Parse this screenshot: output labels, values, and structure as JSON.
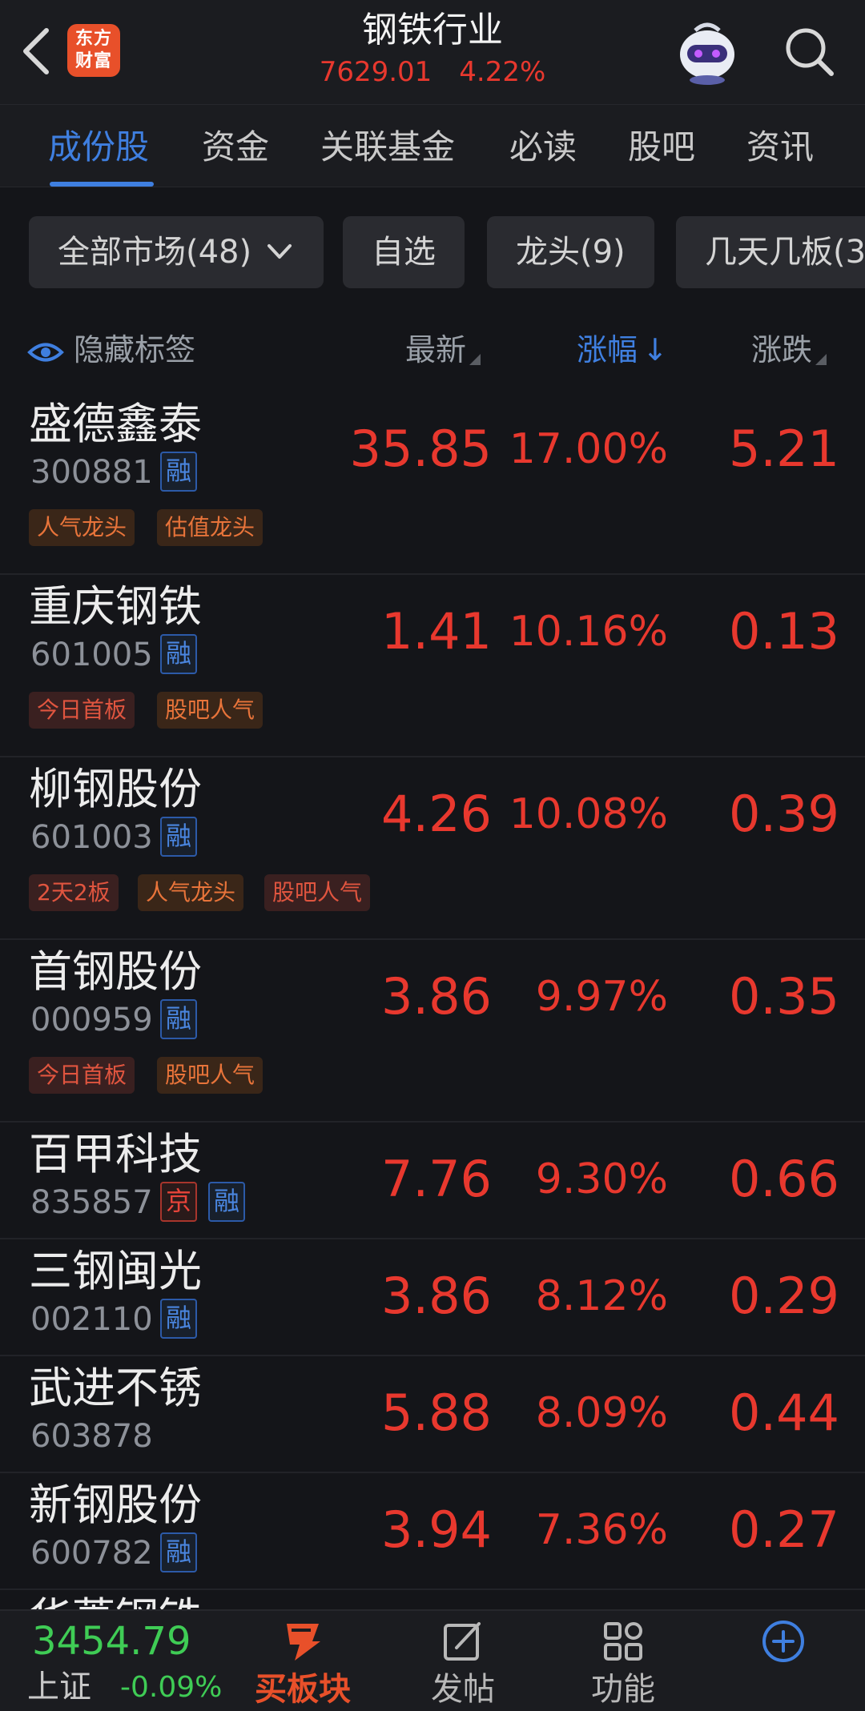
{
  "header": {
    "logo_line1": "东方",
    "logo_line2": "财富",
    "title": "钢铁行业",
    "index_value": "7629.01",
    "index_change": "4.22%"
  },
  "tabs": [
    {
      "label": "成份股",
      "active": true
    },
    {
      "label": "资金"
    },
    {
      "label": "关联基金"
    },
    {
      "label": "必读"
    },
    {
      "label": "股吧"
    },
    {
      "label": "资讯"
    }
  ],
  "filters": [
    {
      "label": "全部市场(48)"
    },
    {
      "label": "自选"
    },
    {
      "label": "龙头(9)"
    },
    {
      "label": "几天几板(3"
    }
  ],
  "columns": {
    "hide_tags": "隐藏标签",
    "latest": "最新",
    "pct": "涨幅",
    "pct_arrow": "↓",
    "change": "涨跌"
  },
  "stocks": [
    {
      "name": "盛德鑫泰",
      "code": "300881",
      "badges": [
        "融"
      ],
      "tags": [
        {
          "text": "人气龙头",
          "tone": "orange"
        },
        {
          "text": "估值龙头",
          "tone": "orange"
        }
      ],
      "price": "35.85",
      "pct": "17.00%",
      "change": "5.21"
    },
    {
      "name": "重庆钢铁",
      "code": "601005",
      "badges": [
        "融"
      ],
      "tags": [
        {
          "text": "今日首板",
          "tone": "red"
        },
        {
          "text": "股吧人气",
          "tone": "orange"
        }
      ],
      "price": "1.41",
      "pct": "10.16%",
      "change": "0.13"
    },
    {
      "name": "柳钢股份",
      "code": "601003",
      "badges": [
        "融"
      ],
      "tags": [
        {
          "text": "2天2板",
          "tone": "red"
        },
        {
          "text": "人气龙头",
          "tone": "orange"
        },
        {
          "text": "股吧人气",
          "tone": "red"
        }
      ],
      "price": "4.26",
      "pct": "10.08%",
      "change": "0.39"
    },
    {
      "name": "首钢股份",
      "code": "000959",
      "badges": [
        "融"
      ],
      "tags": [
        {
          "text": "今日首板",
          "tone": "red"
        },
        {
          "text": "股吧人气",
          "tone": "orange"
        }
      ],
      "price": "3.86",
      "pct": "9.97%",
      "change": "0.35"
    },
    {
      "name": "百甲科技",
      "code": "835857",
      "badges": [
        "京",
        "融"
      ],
      "tags": [],
      "price": "7.76",
      "pct": "9.30%",
      "change": "0.66"
    },
    {
      "name": "三钢闽光",
      "code": "002110",
      "badges": [
        "融"
      ],
      "tags": [],
      "price": "3.86",
      "pct": "8.12%",
      "change": "0.29"
    },
    {
      "name": "武进不锈",
      "code": "603878",
      "badges": [],
      "tags": [],
      "price": "5.88",
      "pct": "8.09%",
      "change": "0.44"
    },
    {
      "name": "新钢股份",
      "code": "600782",
      "badges": [
        "融"
      ],
      "tags": [],
      "price": "3.94",
      "pct": "7.36%",
      "change": "0.27"
    },
    {
      "name": "华菱钢铁",
      "code": "",
      "badges": [],
      "tags": [],
      "price": "",
      "pct": "",
      "change": ""
    }
  ],
  "bottom": {
    "index_value": "3454.79",
    "index_name": "上证",
    "index_pct": "-0.09%",
    "nav": [
      {
        "label": "买板块",
        "icon": "buy-sector-icon"
      },
      {
        "label": "发帖",
        "icon": "compose-icon"
      },
      {
        "label": "功能",
        "icon": "grid-icon"
      },
      {
        "label": "",
        "icon": "plus-circle-icon"
      }
    ]
  },
  "colors": {
    "up": "#e8382e",
    "down": "#3fcc55",
    "accent": "#3f7fe0",
    "brand": "#e8502a"
  }
}
